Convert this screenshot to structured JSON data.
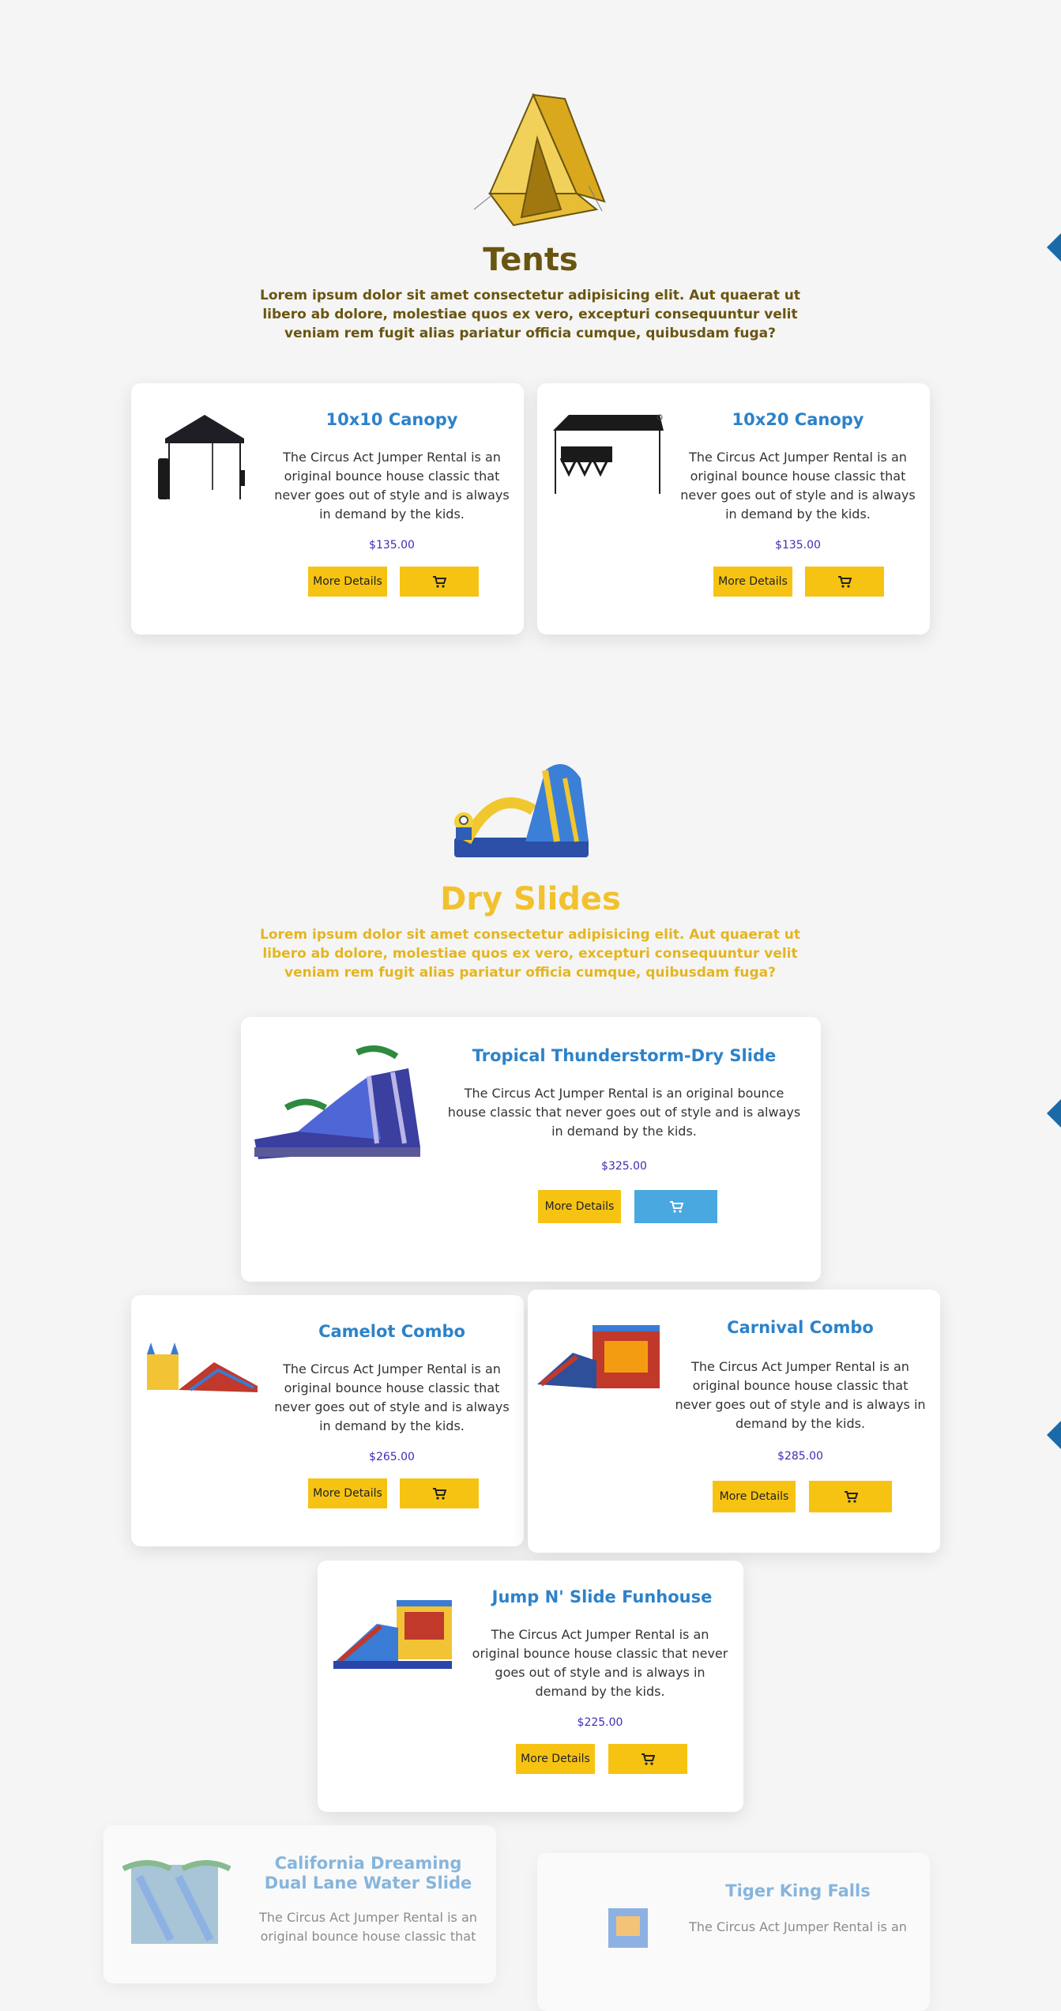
{
  "colors": {
    "tents_title": "#6a5510",
    "tents_desc": "#6a5510",
    "dry_title": "#f2c12e",
    "dry_desc": "#e4b521",
    "card_title": "#2d82c9",
    "price": "#3b2fb3",
    "button": "#f6c313",
    "button_active": "#4aa8e0",
    "arrow": "#1a6aa8"
  },
  "tents": {
    "title": "Tents",
    "description": "Lorem ipsum dolor sit amet consectetur adipisicing elit. Aut quaerat ut libero ab dolore, molestiae quos ex vero, excepturi consequuntur velit veniam rem fugit alias pariatur officia cumque, quibusdam fuga?",
    "icon": "tent-icon",
    "products": [
      {
        "name": "10x10 Canopy",
        "description": "The Circus Act Jumper Rental is an original bounce house classic that never goes out of style and is always in demand by the kids.",
        "price": "$135.00",
        "details_label": "More Details",
        "image": "canopy-10x10-image"
      },
      {
        "name": "10x20 Canopy",
        "description": "The Circus Act Jumper Rental is an original bounce house classic that never goes out of style and is always in demand by the kids.",
        "price": "$135.00",
        "details_label": "More Details",
        "image": "canopy-10x20-image"
      }
    ]
  },
  "dry_slides": {
    "title": "Dry Slides",
    "description": "Lorem ipsum dolor sit amet consectetur adipisicing elit. Aut quaerat ut libero ab dolore, molestiae quos ex vero, excepturi consequuntur velit veniam rem fugit alias pariatur officia cumque, quibusdam fuga?",
    "icon": "slide-icon",
    "products": [
      {
        "name": "Tropical Thunderstorm-Dry Slide",
        "description": "The Circus Act Jumper Rental is an original bounce house classic that never goes out of style and is always in demand by the kids.",
        "price": "$325.00",
        "details_label": "More Details",
        "image": "tropical-slide-image"
      },
      {
        "name": "Camelot Combo",
        "description": "The Circus Act Jumper Rental is an original bounce house classic that never goes out of style and is always in demand by the kids.",
        "price": "$265.00",
        "details_label": "More Details",
        "image": "camelot-combo-image"
      },
      {
        "name": "Carnival Combo",
        "description": "The Circus Act Jumper Rental is an original bounce house classic that never goes out of style and is always in demand by the kids.",
        "price": "$285.00",
        "details_label": "More Details",
        "image": "carnival-combo-image"
      },
      {
        "name": "Jump N' Slide Funhouse",
        "description": "The Circus Act Jumper Rental is an original bounce house classic that never goes out of style and is always in demand by the kids.",
        "price": "$225.00",
        "details_label": "More Details",
        "image": "funhouse-image"
      }
    ]
  },
  "water_slides": {
    "products": [
      {
        "name": "California Dreaming Dual Lane Water Slide",
        "description": "The Circus Act Jumper Rental is an original bounce house classic that",
        "image": "california-slide-image"
      },
      {
        "name": "Tiger King Falls",
        "description": "The Circus Act Jumper Rental is an",
        "image": "tiger-king-image"
      }
    ]
  }
}
